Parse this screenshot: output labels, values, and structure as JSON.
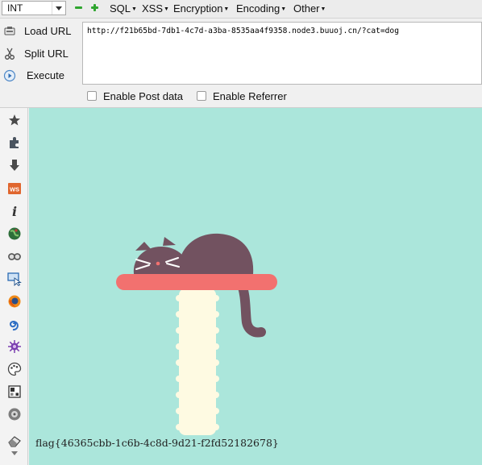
{
  "toolbar": {
    "select_value": "INT",
    "menus": [
      "SQL",
      "XSS",
      "Encryption",
      "Encoding",
      "Other"
    ],
    "icons": [
      "minus-icon",
      "plus-icon"
    ]
  },
  "hackbar": {
    "load_url_label": "Load URL",
    "split_url_label": "Split URL",
    "execute_label": "Execute",
    "url_value": "http://f21b65bd-7db1-4c7d-a3ba-8535aa4f9358.node3.buuoj.cn/?cat=dog",
    "enable_post_label": "Enable Post data",
    "enable_referrer_label": "Enable Referrer"
  },
  "sidebar_icons": [
    "star-icon",
    "puzzle-icon",
    "download-arrow-icon",
    "ws-icon",
    "info-icon",
    "globe-icon",
    "glasses-icon",
    "screen-cursor-icon",
    "firefox-icon",
    "swirl-icon",
    "virus-icon",
    "palette-icon",
    "grid-icon",
    "disc-icon",
    "eraser-icon"
  ],
  "page": {
    "flag_text": "flag{46365cbb-1c6b-4c8d-9d21-f2fd52182678}",
    "colors": {
      "background": "#abe6db",
      "cat": "#725260",
      "shelf": "#f2716f",
      "post": "#fefae2"
    }
  }
}
